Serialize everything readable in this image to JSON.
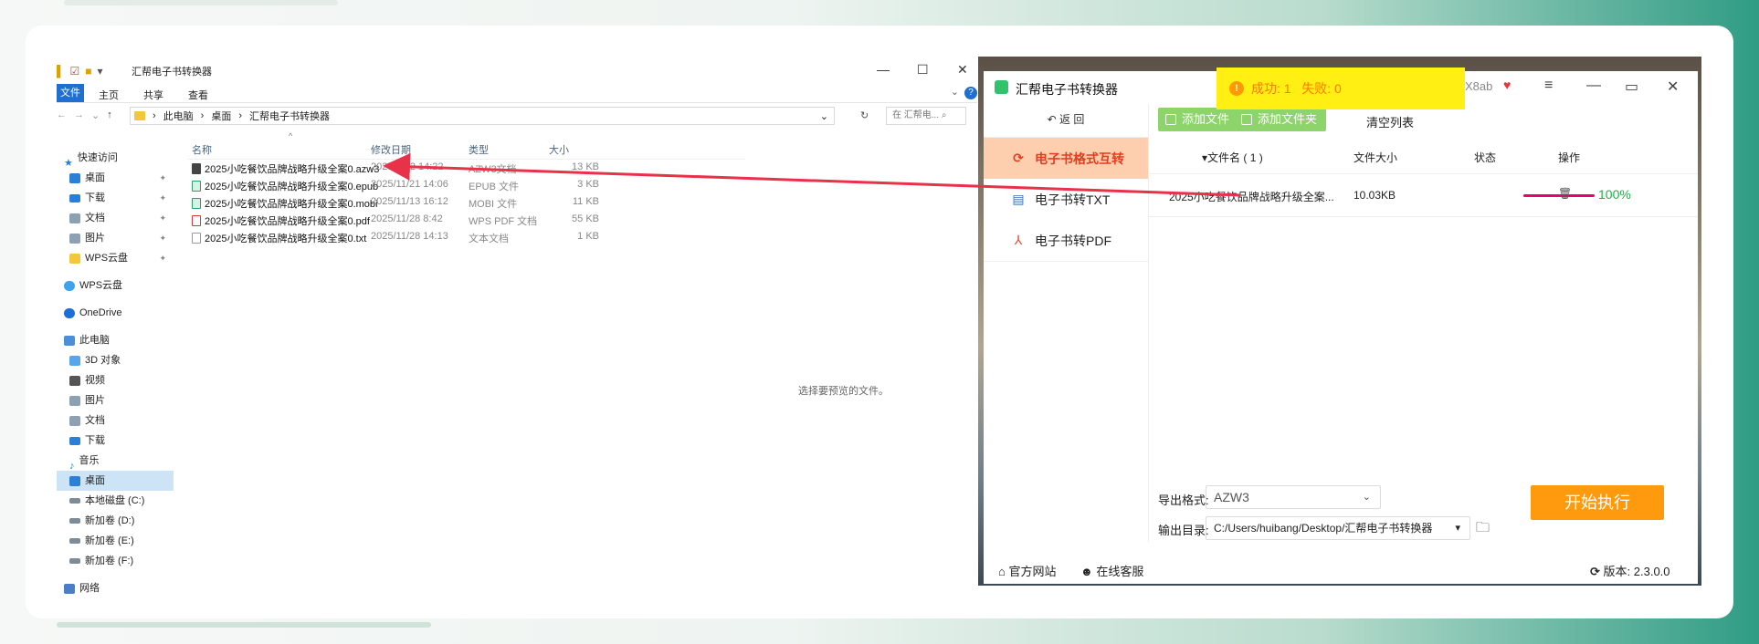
{
  "explorer": {
    "title": "汇帮电子书转换器",
    "ribbon": {
      "file": "文件",
      "home": "主页",
      "share": "共享",
      "view": "查看",
      "help": "?"
    },
    "address": [
      "此电脑",
      "桌面",
      "汇帮电子书转换器"
    ],
    "search_placeholder": "在 汇帮电...",
    "nav": {
      "quick_access": "快速访问",
      "pinned": [
        "桌面",
        "下载",
        "文档",
        "图片",
        "WPS云盘"
      ],
      "wps_cloud": "WPS云盘",
      "onedrive": "OneDrive",
      "this_pc": "此电脑",
      "pc_items": [
        "3D 对象",
        "视频",
        "图片",
        "文档",
        "下载",
        "音乐",
        "桌面",
        "本地磁盘 (C:)",
        "新加卷 (D:)",
        "新加卷 (E:)",
        "新加卷 (F:)"
      ],
      "network": "网络"
    },
    "columns": {
      "name": "名称",
      "date": "修改日期",
      "type": "类型",
      "size": "大小"
    },
    "files": [
      {
        "name": "2025小吃餐饮品牌战略升级全案0.azw3",
        "date": "2025/12/2 14:22",
        "type": "AZW3文档",
        "size": "13 KB"
      },
      {
        "name": "2025小吃餐饮品牌战略升级全案0.epub",
        "date": "2025/11/21 14:06",
        "type": "EPUB 文件",
        "size": "3 KB"
      },
      {
        "name": "2025小吃餐饮品牌战略升级全案0.mobi",
        "date": "2025/11/13 16:12",
        "type": "MOBI 文件",
        "size": "11 KB"
      },
      {
        "name": "2025小吃餐饮品牌战略升级全案0.pdf",
        "date": "2025/11/28 8:42",
        "type": "WPS PDF 文档",
        "size": "55 KB"
      },
      {
        "name": "2025小吃餐饮品牌战略升级全案0.txt",
        "date": "2025/11/28 14:13",
        "type": "文本文档",
        "size": "1 KB"
      }
    ],
    "preview_hint": "选择要预览的文件。"
  },
  "app": {
    "title": "汇帮电子书转换器",
    "account": "X8ab",
    "toast": "成功: 1   失败: 0",
    "back": "返 回",
    "sidebar": [
      "电子书格式互转",
      "电子书转TXT",
      "电子书转PDF"
    ],
    "toolbar": {
      "add_file": "添加文件",
      "add_folder": "添加文件夹",
      "clear": "清空列表"
    },
    "table": {
      "col_name": "▾文件名 ( 1 )",
      "col_size": "文件大小",
      "col_status": "状态",
      "col_action": "操作",
      "row": {
        "name": "2025小吃餐饮品牌战略升级全案...",
        "size": "10.03KB",
        "progress": "100%",
        "progress_value": 1.0
      }
    },
    "export_label": "导出格式:",
    "export_value": "AZW3",
    "output_label": "输出目录:",
    "output_value": "C:/Users/huibang/Desktop/汇帮电子书转换器",
    "start": "开始执行",
    "footer": {
      "website": "官方网站",
      "service": "在线客服",
      "version": "版本: 2.3.0.0"
    }
  },
  "colors": {
    "accent_orange": "#ff9a0e",
    "add_button_green": "#8dd46a",
    "active_tab_bg": "#fdcfae",
    "arrow_red": "#e8324a"
  }
}
